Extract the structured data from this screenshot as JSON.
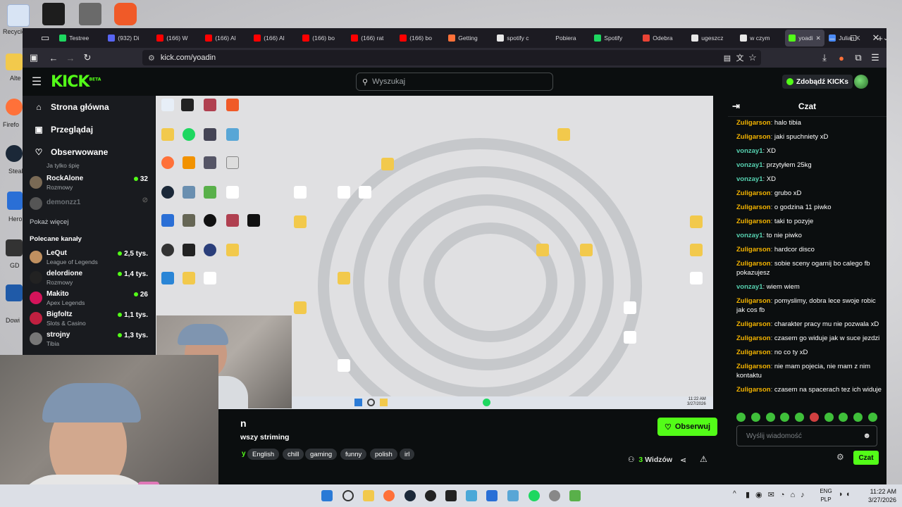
{
  "desktop": {
    "icons": [
      {
        "label": "Recycle",
        "color": "#5a8fd6"
      },
      {
        "label": "",
        "color": "#f0f0f0"
      },
      {
        "label": "",
        "color": "#c04050"
      },
      {
        "label": "",
        "color": "#f05a28"
      }
    ],
    "left_labels": [
      "Recycle",
      "Alte",
      "Firefo",
      "Steal",
      "Hero",
      "GD",
      "Dowi"
    ]
  },
  "browser": {
    "tabs": [
      {
        "label": "Testree",
        "color": "#1ed760"
      },
      {
        "label": "(932) Di",
        "color": "#5865f2"
      },
      {
        "label": "(166) W",
        "color": "#ff0000"
      },
      {
        "label": "(166) Al",
        "color": "#ff0000"
      },
      {
        "label": "(166) Al",
        "color": "#ff0000"
      },
      {
        "label": "(166) bo",
        "color": "#ff0000"
      },
      {
        "label": "(166) rat",
        "color": "#ff0000"
      },
      {
        "label": "(166) bo",
        "color": "#ff0000"
      },
      {
        "label": "Getting",
        "color": "#ff7139"
      },
      {
        "label": "spotify c",
        "color": "#e8e8e8"
      },
      {
        "label": "Pobiera",
        "color": "#1c1b22"
      },
      {
        "label": "Spotify",
        "color": "#1ed760"
      },
      {
        "label": "Odebra",
        "color": "#ea4335"
      },
      {
        "label": "ugeszcz",
        "color": "#e8e8e8"
      },
      {
        "label": "w czym",
        "color": "#e8e8e8"
      },
      {
        "label": "yoadi",
        "color": "#53fc18",
        "active": true
      },
      {
        "label": "Julian K",
        "color": "#4c8bf5"
      }
    ],
    "url": "kick.com/yoadin"
  },
  "kick": {
    "search_placeholder": "Wyszukaj",
    "get_kicks": "Zdobądź KICKs",
    "logo_text": "KICK",
    "logo_beta": "BETA",
    "nav": [
      {
        "label": "Strona główna",
        "icon": "⌂"
      },
      {
        "label": "Przeglądaj",
        "icon": "▣"
      },
      {
        "label": "Obserwowane",
        "icon": "♡"
      }
    ],
    "followed": [
      {
        "name": "",
        "category": "Ja tylko śpię",
        "viewers": "",
        "color": "#555"
      },
      {
        "name": "RockAlone",
        "category": "Rozmowy",
        "viewers": "32",
        "color": "#7a6a55"
      },
      {
        "name": "demonzz1",
        "category": "",
        "viewers": "",
        "color": "#666",
        "offline": true
      }
    ],
    "show_more": "Pokaż więcej",
    "recommended_title": "Polecane kanały",
    "recommended": [
      {
        "name": "LeQut",
        "category": "League of Legends",
        "viewers": "2,5 tys.",
        "color": "#c09060"
      },
      {
        "name": "delordione",
        "category": "Rozmowy",
        "viewers": "1,4 tys.",
        "color": "#222"
      },
      {
        "name": "Makito",
        "category": "Apex Legends",
        "viewers": "26",
        "color": "#d4145a"
      },
      {
        "name": "Bigfoltz",
        "category": "Slots & Casino",
        "viewers": "1,1 tys.",
        "color": "#c02040"
      },
      {
        "name": "strojny",
        "category": "Tibia",
        "viewers": "1,3 tys.",
        "color": "#777"
      }
    ],
    "stream": {
      "title_partial": "n",
      "subtitle_partial": "wszy striming",
      "tag_prefix": "y",
      "tags": [
        "English",
        "chill",
        "gaming",
        "funny",
        "polish",
        "irl"
      ],
      "viewers_count": "3",
      "viewers_label": "Widzów",
      "follow_label": "Obserwuj",
      "stream_clock": "11:22 AM",
      "stream_date": "3/27/2026"
    },
    "chat": {
      "title": "Czat",
      "messages": [
        {
          "user": "Zuligarson",
          "text": "halo tibia",
          "color": "#f4b400"
        },
        {
          "user": "Zuligarson",
          "text": "jaki spuchniety xD",
          "color": "#f4b400"
        },
        {
          "user": "vonzay1",
          "text": "XD",
          "color": "#56d1b0"
        },
        {
          "user": "vonzay1",
          "text": "przytyłem 25kg",
          "color": "#56d1b0"
        },
        {
          "user": "vonzay1",
          "text": "XD",
          "color": "#56d1b0"
        },
        {
          "user": "Zuligarson",
          "text": "grubo xD",
          "color": "#f4b400"
        },
        {
          "user": "Zuligarson",
          "text": "o godzina 11 piwko",
          "color": "#f4b400"
        },
        {
          "user": "Zuligarson",
          "text": "taki to pozyje",
          "color": "#f4b400"
        },
        {
          "user": "vonzay1",
          "text": "to nie piwko",
          "color": "#56d1b0"
        },
        {
          "user": "Zuligarson",
          "text": "hardcor disco",
          "color": "#f4b400"
        },
        {
          "user": "Zuligarson",
          "text": "sobie sceny ogarnij bo calego fb pokazujesz",
          "color": "#f4b400"
        },
        {
          "user": "vonzay1",
          "text": "wiem wiem",
          "color": "#56d1b0"
        },
        {
          "user": "Zuligarson",
          "text": "pomyslimy, dobra lece swoje robic jak cos fb",
          "color": "#f4b400"
        },
        {
          "user": "Zuligarson",
          "text": "charakter pracy mu nie pozwala xD",
          "color": "#f4b400"
        },
        {
          "user": "Zuligarson",
          "text": "czasem go widuje jak w suce jezdzi",
          "color": "#f4b400"
        },
        {
          "user": "Zuligarson",
          "text": "no co ty xD",
          "color": "#f4b400"
        },
        {
          "user": "Zuligarson",
          "text": "nie mam pojecia, nie mam z nim kontaktu",
          "color": "#f4b400"
        },
        {
          "user": "Zuligarson",
          "text": "czasem na spacerach tez ich widuje",
          "color": "#f4b400"
        }
      ],
      "input_placeholder": "Wyślij wiadomość",
      "send_label": "Czat"
    }
  },
  "taskbar": {
    "lang": "ENG",
    "lang2": "PLP",
    "time": "11:22 AM",
    "date": "3/27/2026"
  }
}
